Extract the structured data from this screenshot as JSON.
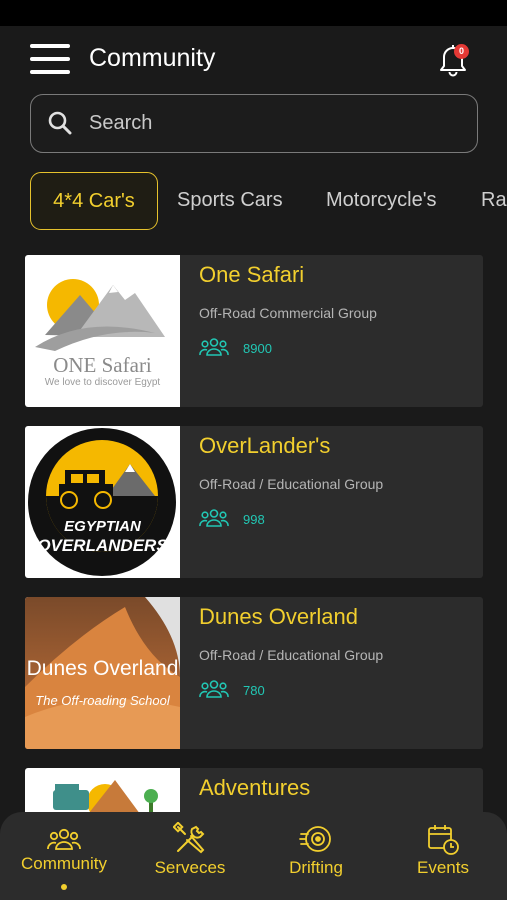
{
  "header": {
    "title": "Community",
    "notification_count": "0"
  },
  "search": {
    "placeholder": "Search"
  },
  "categories": [
    {
      "label": "4*4 Car's",
      "active": true
    },
    {
      "label": "Sports Cars",
      "active": false
    },
    {
      "label": "Motorcycle's",
      "active": false
    },
    {
      "label": "Ral",
      "active": false
    }
  ],
  "groups": [
    {
      "title": "One Safari",
      "subtitle": "Off-Road Commercial Group",
      "members": "8900",
      "logo": {
        "name": "ONE Safari",
        "tagline": "We love to discover Egypt"
      }
    },
    {
      "title": "OverLander's",
      "subtitle": "Off-Road / Educational Group",
      "members": "998",
      "logo": {
        "top": "EGYPTIAN",
        "bottom": "OVERLANDERS"
      }
    },
    {
      "title": "Dunes Overland",
      "subtitle": "Off-Road / Educational Group",
      "members": "780",
      "logo": {
        "name": "Dunes Overland",
        "tagline": "The Off-roading School"
      }
    },
    {
      "title": "Adventures"
    }
  ],
  "bottom_nav": [
    {
      "label": "Community",
      "icon": "community-icon",
      "active": true
    },
    {
      "label": "Serveces",
      "icon": "tools-icon",
      "active": false
    },
    {
      "label": "Drifting",
      "icon": "tire-icon",
      "active": false
    },
    {
      "label": "Events",
      "icon": "calendar-icon",
      "active": false
    }
  ],
  "colors": {
    "accent": "#f2cf2e",
    "members": "#22c7b4",
    "card_bg": "#2c2c2c",
    "page_bg": "#1a1a1a"
  }
}
